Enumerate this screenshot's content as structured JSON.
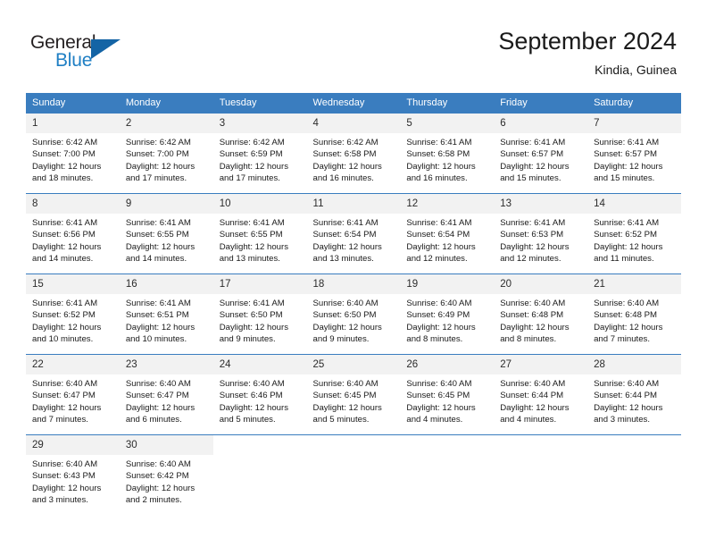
{
  "brand": {
    "name_top": "General",
    "name_bottom": "Blue",
    "color_dark": "#231f20",
    "color_blue": "#1f7fc4",
    "triangle_color": "#1464a5"
  },
  "header": {
    "title": "September 2024",
    "subtitle": "Kindia, Guinea"
  },
  "theme": {
    "header_row_bg": "#3a7dbf",
    "day_number_bg": "#f2f2f2",
    "row_divider": "#3a7dbf",
    "text": "#1a1a1a"
  },
  "weekdays": [
    "Sunday",
    "Monday",
    "Tuesday",
    "Wednesday",
    "Thursday",
    "Friday",
    "Saturday"
  ],
  "weeks": [
    [
      {
        "day": "1",
        "sunrise": "Sunrise: 6:42 AM",
        "sunset": "Sunset: 7:00 PM",
        "daylight1": "Daylight: 12 hours",
        "daylight2": "and 18 minutes."
      },
      {
        "day": "2",
        "sunrise": "Sunrise: 6:42 AM",
        "sunset": "Sunset: 7:00 PM",
        "daylight1": "Daylight: 12 hours",
        "daylight2": "and 17 minutes."
      },
      {
        "day": "3",
        "sunrise": "Sunrise: 6:42 AM",
        "sunset": "Sunset: 6:59 PM",
        "daylight1": "Daylight: 12 hours",
        "daylight2": "and 17 minutes."
      },
      {
        "day": "4",
        "sunrise": "Sunrise: 6:42 AM",
        "sunset": "Sunset: 6:58 PM",
        "daylight1": "Daylight: 12 hours",
        "daylight2": "and 16 minutes."
      },
      {
        "day": "5",
        "sunrise": "Sunrise: 6:41 AM",
        "sunset": "Sunset: 6:58 PM",
        "daylight1": "Daylight: 12 hours",
        "daylight2": "and 16 minutes."
      },
      {
        "day": "6",
        "sunrise": "Sunrise: 6:41 AM",
        "sunset": "Sunset: 6:57 PM",
        "daylight1": "Daylight: 12 hours",
        "daylight2": "and 15 minutes."
      },
      {
        "day": "7",
        "sunrise": "Sunrise: 6:41 AM",
        "sunset": "Sunset: 6:57 PM",
        "daylight1": "Daylight: 12 hours",
        "daylight2": "and 15 minutes."
      }
    ],
    [
      {
        "day": "8",
        "sunrise": "Sunrise: 6:41 AM",
        "sunset": "Sunset: 6:56 PM",
        "daylight1": "Daylight: 12 hours",
        "daylight2": "and 14 minutes."
      },
      {
        "day": "9",
        "sunrise": "Sunrise: 6:41 AM",
        "sunset": "Sunset: 6:55 PM",
        "daylight1": "Daylight: 12 hours",
        "daylight2": "and 14 minutes."
      },
      {
        "day": "10",
        "sunrise": "Sunrise: 6:41 AM",
        "sunset": "Sunset: 6:55 PM",
        "daylight1": "Daylight: 12 hours",
        "daylight2": "and 13 minutes."
      },
      {
        "day": "11",
        "sunrise": "Sunrise: 6:41 AM",
        "sunset": "Sunset: 6:54 PM",
        "daylight1": "Daylight: 12 hours",
        "daylight2": "and 13 minutes."
      },
      {
        "day": "12",
        "sunrise": "Sunrise: 6:41 AM",
        "sunset": "Sunset: 6:54 PM",
        "daylight1": "Daylight: 12 hours",
        "daylight2": "and 12 minutes."
      },
      {
        "day": "13",
        "sunrise": "Sunrise: 6:41 AM",
        "sunset": "Sunset: 6:53 PM",
        "daylight1": "Daylight: 12 hours",
        "daylight2": "and 12 minutes."
      },
      {
        "day": "14",
        "sunrise": "Sunrise: 6:41 AM",
        "sunset": "Sunset: 6:52 PM",
        "daylight1": "Daylight: 12 hours",
        "daylight2": "and 11 minutes."
      }
    ],
    [
      {
        "day": "15",
        "sunrise": "Sunrise: 6:41 AM",
        "sunset": "Sunset: 6:52 PM",
        "daylight1": "Daylight: 12 hours",
        "daylight2": "and 10 minutes."
      },
      {
        "day": "16",
        "sunrise": "Sunrise: 6:41 AM",
        "sunset": "Sunset: 6:51 PM",
        "daylight1": "Daylight: 12 hours",
        "daylight2": "and 10 minutes."
      },
      {
        "day": "17",
        "sunrise": "Sunrise: 6:41 AM",
        "sunset": "Sunset: 6:50 PM",
        "daylight1": "Daylight: 12 hours",
        "daylight2": "and 9 minutes."
      },
      {
        "day": "18",
        "sunrise": "Sunrise: 6:40 AM",
        "sunset": "Sunset: 6:50 PM",
        "daylight1": "Daylight: 12 hours",
        "daylight2": "and 9 minutes."
      },
      {
        "day": "19",
        "sunrise": "Sunrise: 6:40 AM",
        "sunset": "Sunset: 6:49 PM",
        "daylight1": "Daylight: 12 hours",
        "daylight2": "and 8 minutes."
      },
      {
        "day": "20",
        "sunrise": "Sunrise: 6:40 AM",
        "sunset": "Sunset: 6:48 PM",
        "daylight1": "Daylight: 12 hours",
        "daylight2": "and 8 minutes."
      },
      {
        "day": "21",
        "sunrise": "Sunrise: 6:40 AM",
        "sunset": "Sunset: 6:48 PM",
        "daylight1": "Daylight: 12 hours",
        "daylight2": "and 7 minutes."
      }
    ],
    [
      {
        "day": "22",
        "sunrise": "Sunrise: 6:40 AM",
        "sunset": "Sunset: 6:47 PM",
        "daylight1": "Daylight: 12 hours",
        "daylight2": "and 7 minutes."
      },
      {
        "day": "23",
        "sunrise": "Sunrise: 6:40 AM",
        "sunset": "Sunset: 6:47 PM",
        "daylight1": "Daylight: 12 hours",
        "daylight2": "and 6 minutes."
      },
      {
        "day": "24",
        "sunrise": "Sunrise: 6:40 AM",
        "sunset": "Sunset: 6:46 PM",
        "daylight1": "Daylight: 12 hours",
        "daylight2": "and 5 minutes."
      },
      {
        "day": "25",
        "sunrise": "Sunrise: 6:40 AM",
        "sunset": "Sunset: 6:45 PM",
        "daylight1": "Daylight: 12 hours",
        "daylight2": "and 5 minutes."
      },
      {
        "day": "26",
        "sunrise": "Sunrise: 6:40 AM",
        "sunset": "Sunset: 6:45 PM",
        "daylight1": "Daylight: 12 hours",
        "daylight2": "and 4 minutes."
      },
      {
        "day": "27",
        "sunrise": "Sunrise: 6:40 AM",
        "sunset": "Sunset: 6:44 PM",
        "daylight1": "Daylight: 12 hours",
        "daylight2": "and 4 minutes."
      },
      {
        "day": "28",
        "sunrise": "Sunrise: 6:40 AM",
        "sunset": "Sunset: 6:44 PM",
        "daylight1": "Daylight: 12 hours",
        "daylight2": "and 3 minutes."
      }
    ],
    [
      {
        "day": "29",
        "sunrise": "Sunrise: 6:40 AM",
        "sunset": "Sunset: 6:43 PM",
        "daylight1": "Daylight: 12 hours",
        "daylight2": "and 3 minutes."
      },
      {
        "day": "30",
        "sunrise": "Sunrise: 6:40 AM",
        "sunset": "Sunset: 6:42 PM",
        "daylight1": "Daylight: 12 hours",
        "daylight2": "and 2 minutes."
      },
      {
        "day": "",
        "sunrise": "",
        "sunset": "",
        "daylight1": "",
        "daylight2": ""
      },
      {
        "day": "",
        "sunrise": "",
        "sunset": "",
        "daylight1": "",
        "daylight2": ""
      },
      {
        "day": "",
        "sunrise": "",
        "sunset": "",
        "daylight1": "",
        "daylight2": ""
      },
      {
        "day": "",
        "sunrise": "",
        "sunset": "",
        "daylight1": "",
        "daylight2": ""
      },
      {
        "day": "",
        "sunrise": "",
        "sunset": "",
        "daylight1": "",
        "daylight2": ""
      }
    ]
  ]
}
